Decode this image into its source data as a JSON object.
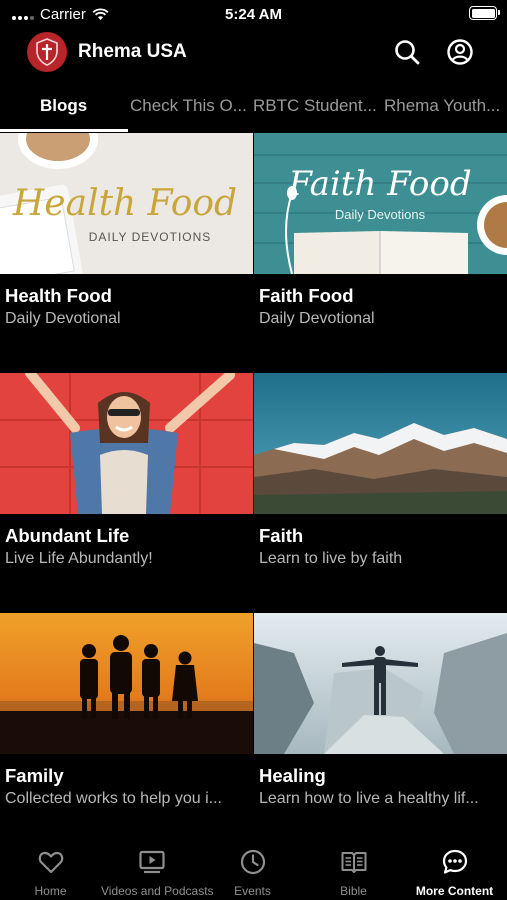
{
  "status_bar": {
    "carrier": "Carrier",
    "time": "5:24 AM"
  },
  "header": {
    "title": "Rhema USA",
    "icons": [
      "search-icon",
      "account-icon"
    ]
  },
  "tabs": [
    {
      "label": "Blogs",
      "active": true
    },
    {
      "label": "Check This O...",
      "active": false
    },
    {
      "label": "RBTC Student...",
      "active": false
    },
    {
      "label": "Rhema Youth...",
      "active": false
    }
  ],
  "thumbnails": {
    "health_food": {
      "script": "Health Food",
      "caption": "DAILY DEVOTIONS"
    },
    "faith_food": {
      "script": "Faith Food",
      "caption": "Daily Devotions"
    }
  },
  "cards": [
    {
      "title": "Health Food",
      "subtitle": "Daily Devotional"
    },
    {
      "title": "Faith Food",
      "subtitle": "Daily Devotional"
    },
    {
      "title": "Abundant Life",
      "subtitle": "Live Life Abundantly!"
    },
    {
      "title": "Faith",
      "subtitle": "Learn to live by faith"
    },
    {
      "title": "Family",
      "subtitle": "Collected works to help you i..."
    },
    {
      "title": "Healing",
      "subtitle": "Learn how to live a healthy lif..."
    }
  ],
  "tabbar": [
    {
      "label": "Home",
      "icon": "heart-icon",
      "active": false
    },
    {
      "label": "Videos and Podcasts",
      "icon": "play-icon",
      "active": false
    },
    {
      "label": "Events",
      "icon": "clock-icon",
      "active": false
    },
    {
      "label": "Bible",
      "icon": "book-icon",
      "active": false
    },
    {
      "label": "More Content",
      "icon": "chat-icon",
      "active": true
    }
  ]
}
